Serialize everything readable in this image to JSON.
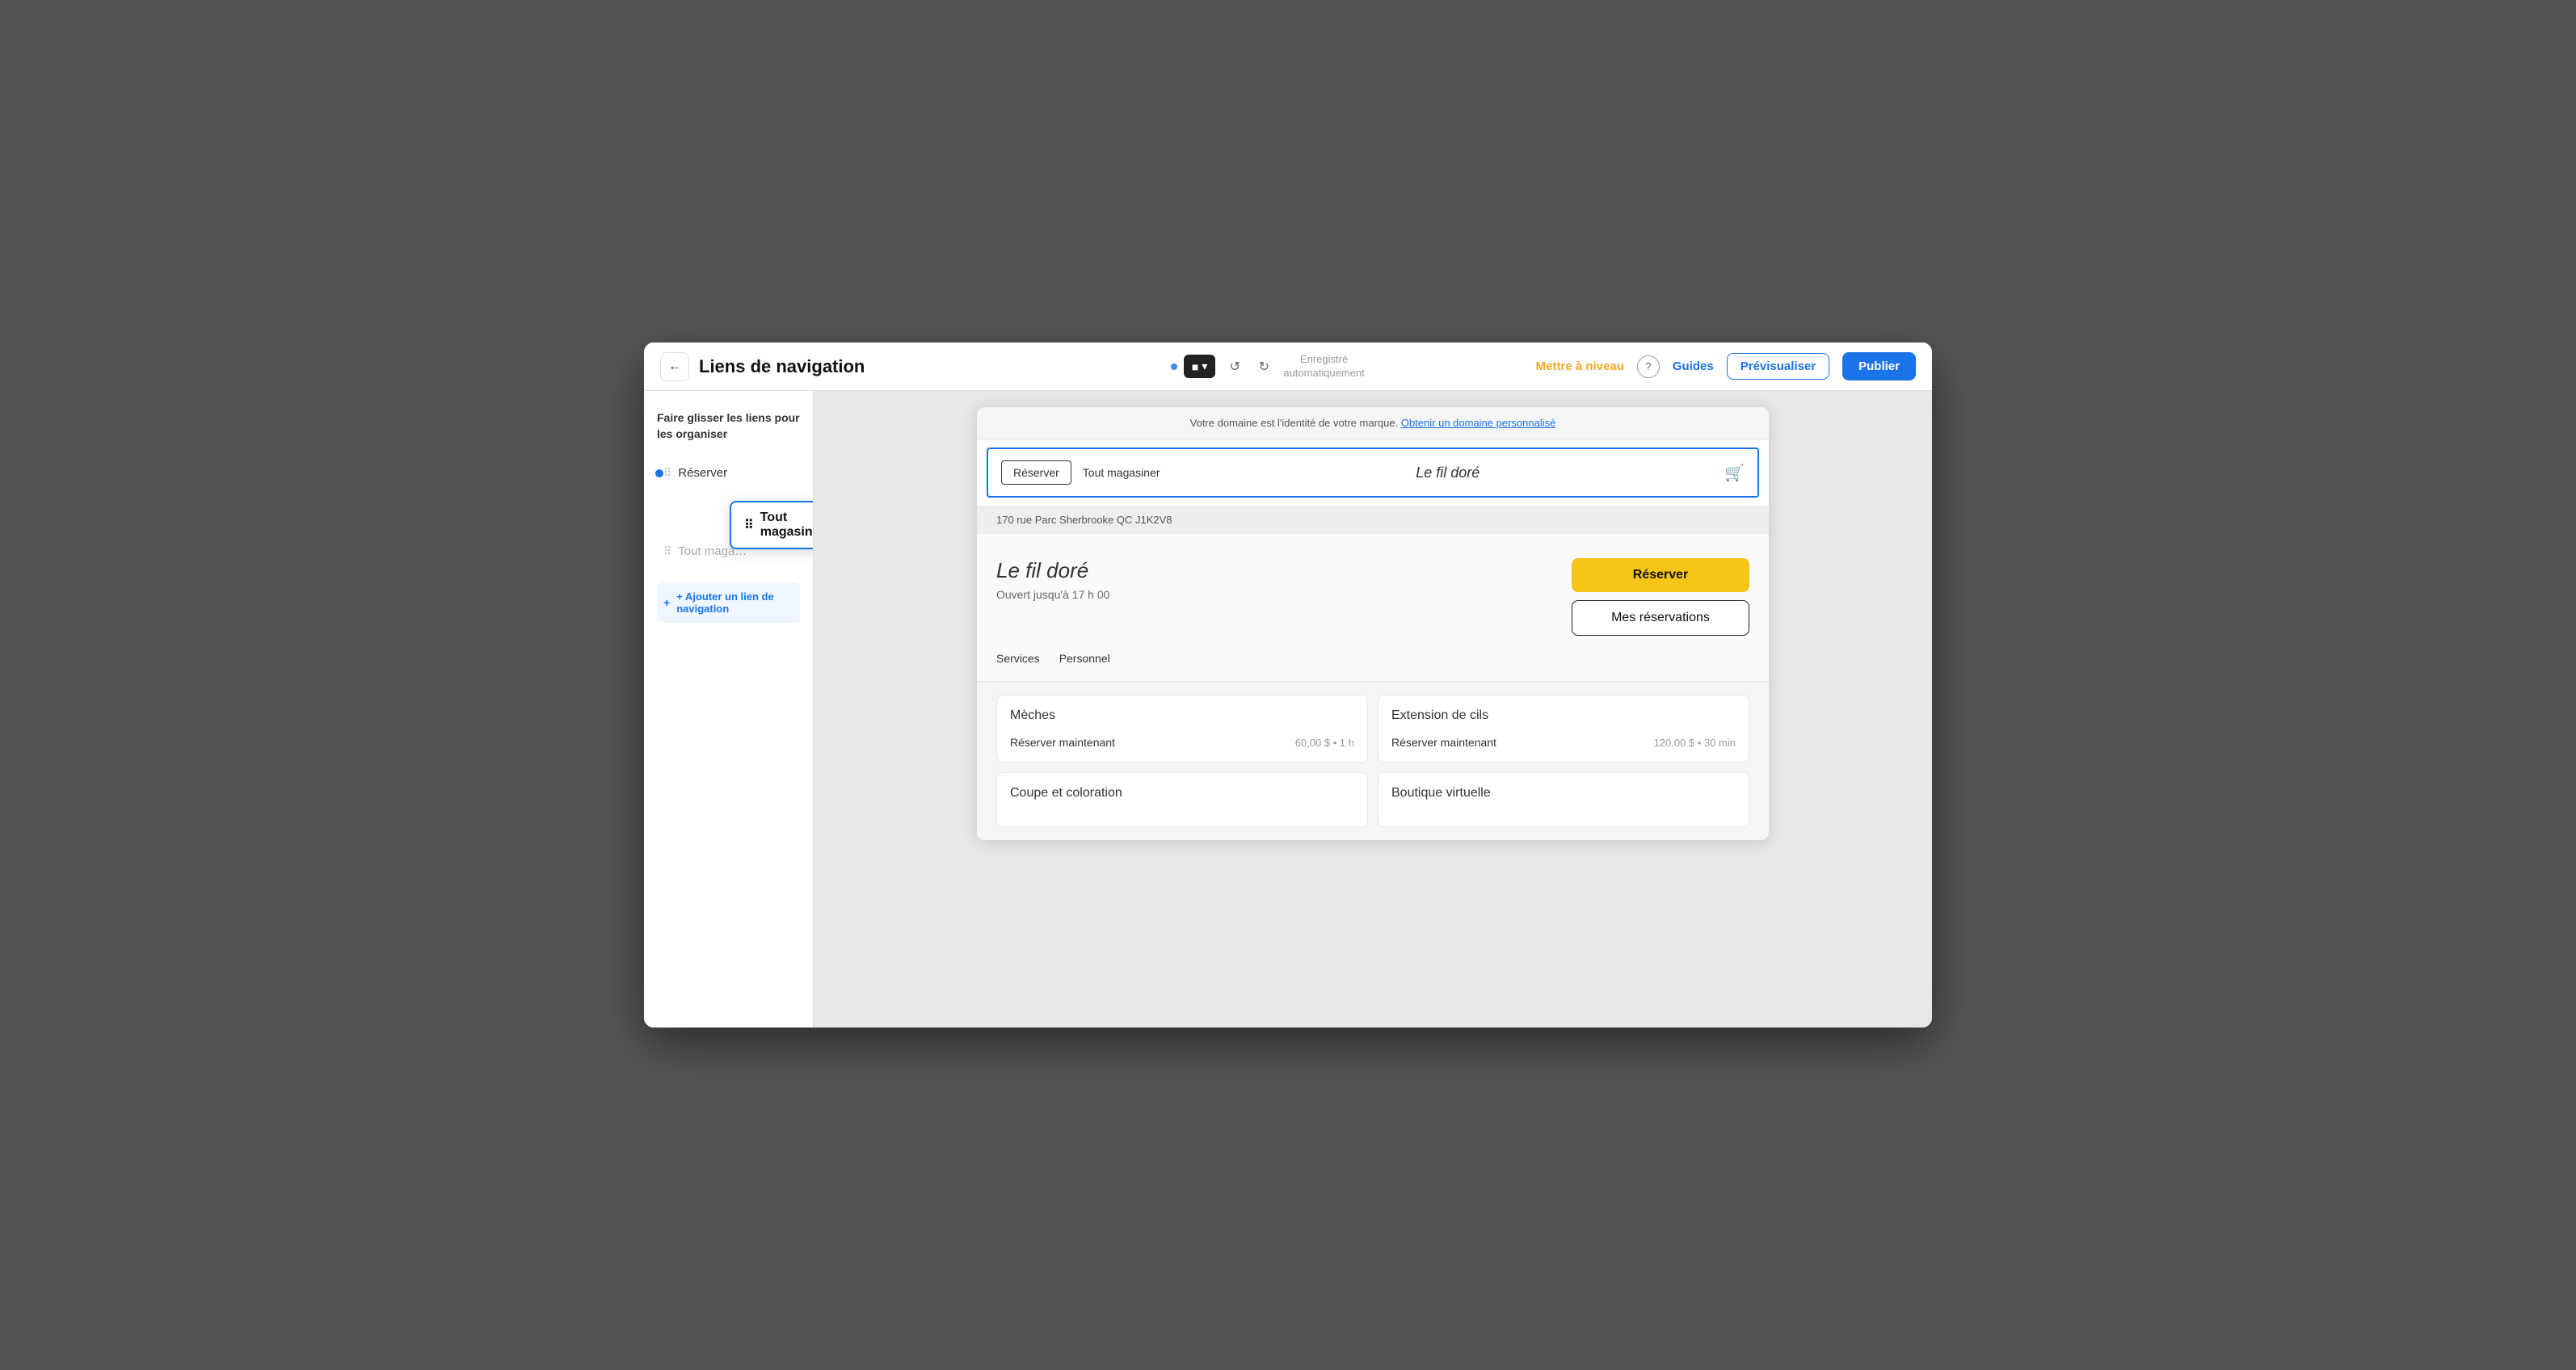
{
  "toolbar": {
    "back_label": "←",
    "page_title": "Liens de navigation",
    "device_icon": "■",
    "device_dropdown": "▾",
    "undo_icon": "↺",
    "redo_icon": "↻",
    "auto_saved_line1": "Enregistré",
    "auto_saved_line2": "automatiquement",
    "upgrade_label": "Mettre à niveau",
    "help_label": "?",
    "guides_label": "Guides",
    "preview_label": "Prévisualiser",
    "publish_label": "Publier"
  },
  "sidebar": {
    "instruction": "Faire glisser les liens pour les organiser",
    "nav_items": [
      {
        "label": "Réserver",
        "type": "active",
        "has_dot": true
      },
      {
        "label": "Tout magasiner",
        "type": "dragged"
      },
      {
        "label": "Tout maga…",
        "type": "muted"
      }
    ],
    "add_link_label": "+ Ajouter un lien de navigation"
  },
  "domain_banner": {
    "text": "Votre domaine est l'identité de votre marque.",
    "link_text": "Obtenir un domaine personnalisé"
  },
  "preview_navbar": {
    "link1": "Réserver",
    "link2": "Tout magasiner",
    "brand": "Le fil doré",
    "cart_icon": "🛒"
  },
  "address_bar": {
    "text": "170 rue Parc Sherbrooke QC J1K2V8"
  },
  "business": {
    "name": "Le fil doré",
    "hours": "Ouvert jusqu'à 17 h 00",
    "reserver_btn": "Réserver",
    "mes_reservations_btn": "Mes réservations"
  },
  "service_tabs": [
    {
      "label": "Services"
    },
    {
      "label": "Personnel"
    }
  ],
  "service_cards": [
    {
      "name": "Mèches",
      "link": "Réserver maintenant",
      "price": "60,00 $",
      "duration": "1 h"
    },
    {
      "name": "Extension de cils",
      "link": "Réserver maintenant",
      "price": "120,00 $",
      "duration": "30 min"
    },
    {
      "name": "Coupe et coloration",
      "link": "",
      "price": "",
      "duration": ""
    },
    {
      "name": "Boutique virtuelle",
      "link": "",
      "price": "",
      "duration": ""
    }
  ]
}
